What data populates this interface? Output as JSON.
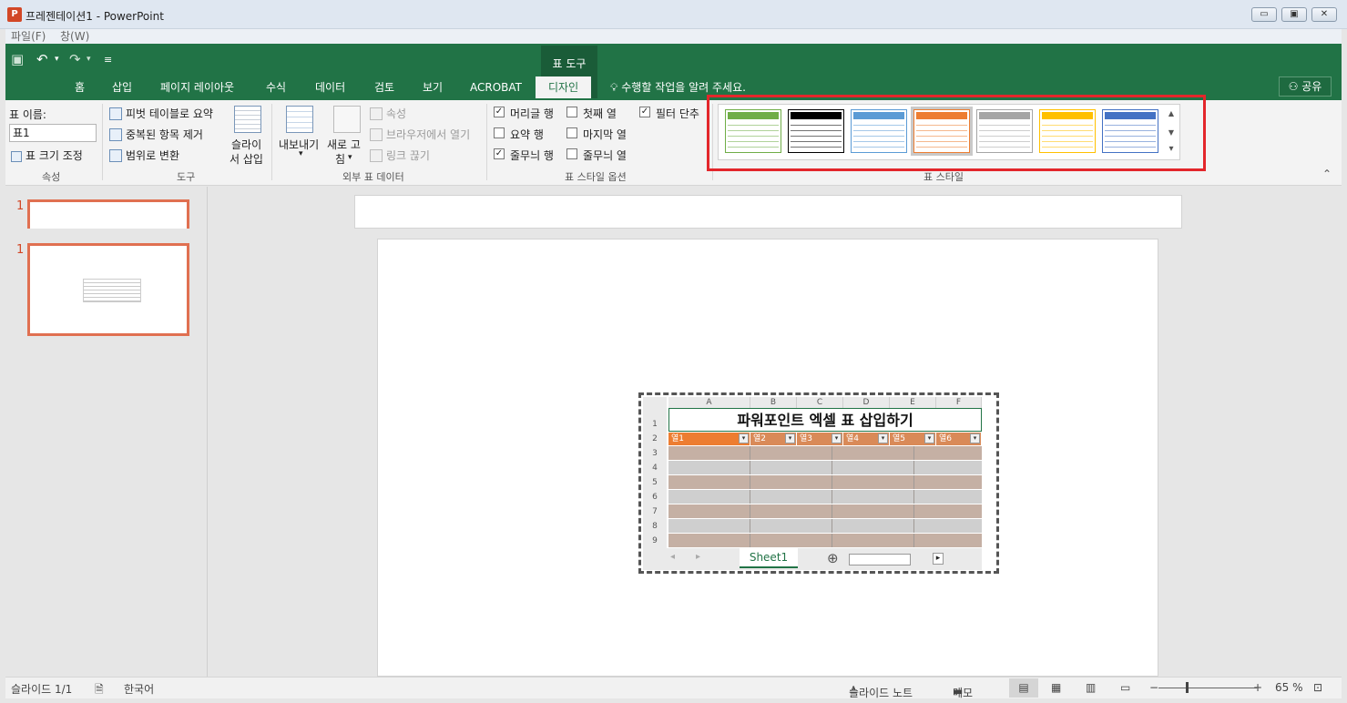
{
  "window": {
    "title": "프레젠테이션1 - PowerPoint",
    "app_icon_letter": "P",
    "minimize_glyph": "▭",
    "restore_glyph": "▣",
    "close_glyph": "✕"
  },
  "menubar": {
    "items": [
      "파일(F)",
      "창(W)"
    ]
  },
  "quick_access": {
    "save": "▣",
    "undo": "↶",
    "undo_drop": "▾",
    "redo": "↷",
    "redo_drop": "▾",
    "customize": "≡"
  },
  "ribbon": {
    "context_group": "표 도구",
    "tabs": [
      "홈",
      "삽입",
      "페이지 레이아웃",
      "수식",
      "데이터",
      "검토",
      "보기",
      "ACROBAT",
      "디자인"
    ],
    "active_tab": "디자인",
    "tell_me": "수행할 작업을 알려 주세요.",
    "share": "공유",
    "groups": {
      "properties": {
        "label": "속성",
        "table_name_label": "표 이름:",
        "table_name_value": "표1",
        "resize": "표 크기 조정"
      },
      "tools": {
        "label": "도구",
        "pivot": "피벗 테이블로 요약",
        "remove_dup": "중복된 항목 제거",
        "convert": "범위로 변환",
        "slicer_line1": "슬라이",
        "slicer_line2": "서 삽입"
      },
      "external": {
        "label": "외부 표 데이터",
        "export": "내보내기",
        "export_drop": "▾",
        "refresh_line1": "새로 고",
        "refresh_line2": "침",
        "refresh_drop": "▾",
        "properties": "속성",
        "open_browser": "브라우저에서 열기",
        "unlink": "링크 끊기"
      },
      "style_options": {
        "label": "표 스타일 옵션",
        "header_row": {
          "label": "머리글 행",
          "checked": true
        },
        "total_row": {
          "label": "요약 행",
          "checked": false
        },
        "banded_rows": {
          "label": "줄무늬 행",
          "checked": true
        },
        "first_column": {
          "label": "첫째 열",
          "checked": false
        },
        "last_column": {
          "label": "마지막 열",
          "checked": false
        },
        "banded_columns": {
          "label": "줄무늬 열",
          "checked": false
        },
        "filter_button": {
          "label": "필터 단추",
          "checked": true
        },
        "check_glyph": "✓"
      },
      "table_styles": {
        "label": "표 스타일",
        "swatch_colors": [
          "#70ad47",
          "#000000",
          "#5b9bd5",
          "#ed7d31",
          "#a5a5a5",
          "#ffc000",
          "#4472c4"
        ],
        "selected_index": 3,
        "scroll_up": "▲",
        "scroll_down": "▼",
        "more": "▾"
      }
    },
    "collapse_glyph": "⌃"
  },
  "slides_pane": {
    "thumbnails": [
      {
        "number": "1"
      },
      {
        "number": "1"
      }
    ]
  },
  "excel": {
    "title": "파워포인트 엑셀 표 삽입하기",
    "columns": [
      "A",
      "B",
      "C",
      "D",
      "E",
      "F"
    ],
    "row_numbers": [
      "1",
      "2",
      "3",
      "4",
      "5",
      "6",
      "7",
      "8",
      "9"
    ],
    "headers": [
      "열1",
      "열2",
      "열3",
      "열4",
      "열5",
      "열6"
    ],
    "dropdown_glyph": "▾",
    "sheet_tab": "Sheet1",
    "add_sheet": "⊕",
    "nav_prev": "◂",
    "nav_next": "▸",
    "scroll_right": "▸",
    "colors": {
      "header": "#ed7d31",
      "band_dark": "#c5b0a4",
      "band_light": "#cfcfcf"
    }
  },
  "statusbar": {
    "slide_info": "슬라이드 1/1",
    "language": "한국어",
    "notes": "슬라이드 노트",
    "comments": "메모",
    "zoom_minus": "−",
    "zoom_plus": "+",
    "zoom": "65 %",
    "zoom_fraction": 0.65
  },
  "colors": {
    "accent": "#217346",
    "highlight": "#e3262b",
    "thumb_border": "#e07051"
  }
}
